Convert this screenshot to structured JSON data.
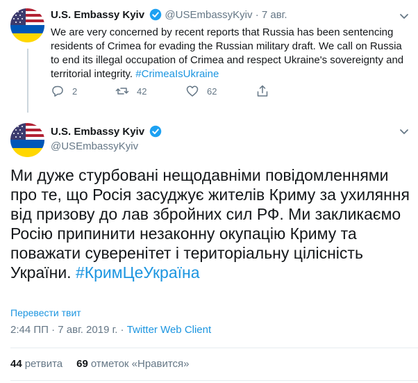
{
  "parent_tweet": {
    "author_name": "U.S. Embassy Kyiv",
    "handle": "@USEmbassyKyiv",
    "separator": "·",
    "date": "7 авг.",
    "text": "We are very concerned by recent reports that Russia has been sentencing residents of Crimea for evading the Russian military draft. We call on Russia to end its illegal occupation of Crimea and respect Ukraine's sovereignty and territorial integrity. ",
    "hashtag": "#CrimeaIsUkraine",
    "actions": {
      "replies": "2",
      "retweets": "42",
      "likes": "62"
    }
  },
  "main_tweet": {
    "author_name": "U.S. Embassy Kyiv",
    "handle": "@USEmbassyKyiv",
    "text": "Ми дуже стурбовані нещодавніми повідомленнями про те, що Росія засуджує жителів Криму за ухиляння від призову до лав збройних сил РФ. Ми закликаємо Росію припинити незаконну окупацію Криму та поважати суверенітет і територіальну цілісність України. ",
    "hashtag": "#КримЦеУкраїна",
    "translate_link": "Перевести твит",
    "timestamp": "2:44 ПП · 7 авг. 2019 г. · ",
    "client": "Twitter Web Client",
    "retweet_count": "44",
    "retweet_label": "ретвита",
    "like_count": "69",
    "like_label": "отметок «Нравится»"
  },
  "colors": {
    "accent": "#1b95e0",
    "muted": "#657786",
    "verified": "#1da1f2",
    "divider": "#e6ecf0"
  },
  "icons": [
    "avatar-flag-us-ukraine",
    "verified-badge-icon",
    "chevron-down-icon",
    "reply-icon",
    "retweet-icon",
    "like-icon",
    "share-icon"
  ]
}
